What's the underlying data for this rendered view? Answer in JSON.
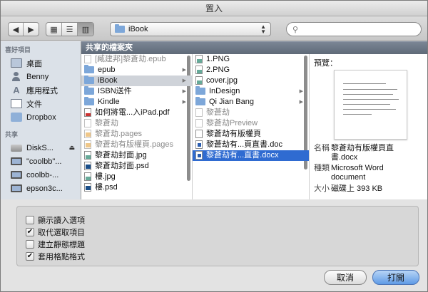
{
  "window": {
    "title": "置入"
  },
  "toolbar": {
    "location": "iBook",
    "view_icons": [
      "icon-view",
      "list-view",
      "column-view"
    ]
  },
  "sidebar": {
    "favorites_header": "喜好項目",
    "favorites": [
      {
        "label": "桌面",
        "icon": "desktop-icon"
      },
      {
        "label": "Benny",
        "icon": "home-icon"
      },
      {
        "label": "應用程式",
        "icon": "applications-icon"
      },
      {
        "label": "文件",
        "icon": "documents-icon"
      },
      {
        "label": "Dropbox",
        "icon": "folder-icon"
      }
    ],
    "shared_header": "共享",
    "shared": [
      {
        "label": "DiskS...",
        "icon": "disk-icon",
        "eject": "⏏"
      },
      {
        "label": "\"coolbb\"...",
        "icon": "computer-icon"
      },
      {
        "label": "coolbb-...",
        "icon": "computer-icon"
      },
      {
        "label": "epson3c...",
        "icon": "computer-icon"
      }
    ]
  },
  "path_header": "共享的檔案夾",
  "columns": [
    {
      "items": [
        {
          "label": "[臧建邦]黎蒼劫.epub",
          "type": "doc",
          "dim": true
        },
        {
          "label": "epub",
          "type": "folder",
          "arrow": "▶"
        },
        {
          "label": "iBook",
          "type": "folder",
          "arrow": "▶",
          "selected": "gray"
        },
        {
          "label": "ISBN送件",
          "type": "folder",
          "arrow": "▶"
        },
        {
          "label": "Kindle",
          "type": "folder",
          "arrow": "▶"
        },
        {
          "label": "如何將電...入iPad.pdf",
          "type": "pdf"
        },
        {
          "label": "黎蒼劫",
          "type": "doc",
          "dim": true
        },
        {
          "label": "黎蒼劫.pages",
          "type": "pages",
          "dim": true
        },
        {
          "label": "黎蒼劫有版權頁.pages",
          "type": "pages",
          "dim": true
        },
        {
          "label": "黎蒼劫封面.jpg",
          "type": "img"
        },
        {
          "label": "黎蒼劫封面.psd",
          "type": "psd"
        },
        {
          "label": "樓.jpg",
          "type": "img"
        },
        {
          "label": "樓.psd",
          "type": "psd"
        }
      ]
    },
    {
      "items": [
        {
          "label": "1.PNG",
          "type": "img"
        },
        {
          "label": "2.PNG",
          "type": "img"
        },
        {
          "label": "cover.jpg",
          "type": "img"
        },
        {
          "label": "InDesign",
          "type": "folder",
          "arrow": "▶"
        },
        {
          "label": "Qi Jian Bang",
          "type": "folder",
          "arrow": "▶"
        },
        {
          "label": "黎蒼劫",
          "type": "doc",
          "dim": true
        },
        {
          "label": "黎蒼劫Preview",
          "type": "doc",
          "dim": true
        },
        {
          "label": "黎蒼劫有版權頁",
          "type": "doc"
        },
        {
          "label": "黎蒼劫有...頁直書.doc",
          "type": "word"
        },
        {
          "label": "黎蒼劫有...直書.docx",
          "type": "word",
          "selected": "blue"
        }
      ]
    }
  ],
  "preview": {
    "label": "預覽：",
    "fields": [
      {
        "key": "名稱",
        "value": "黎蒼劫有版權頁直書.docx"
      },
      {
        "key": "種類",
        "value": "Microsoft Word document"
      },
      {
        "key": "大小",
        "value": "磁碟上 393 KB"
      }
    ]
  },
  "options": [
    {
      "label": "顯示讀入選項",
      "checked": false
    },
    {
      "label": "取代選取項目",
      "checked": true
    },
    {
      "label": "建立靜態標題",
      "checked": false
    },
    {
      "label": "套用格點格式",
      "checked": true
    }
  ],
  "buttons": {
    "cancel": "取消",
    "open": "打開"
  }
}
